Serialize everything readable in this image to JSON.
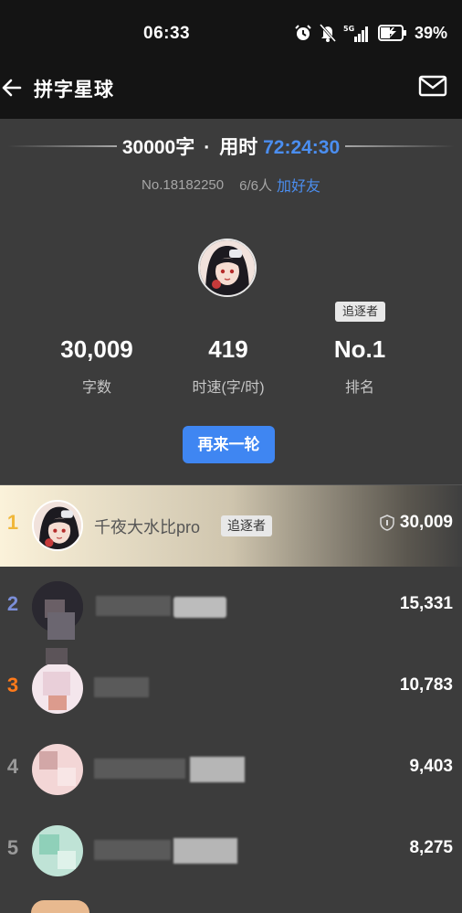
{
  "status_bar": {
    "time": "06:33",
    "battery": "39%"
  },
  "app_bar": {
    "title": "拼字星球"
  },
  "summary": {
    "words": "30000字",
    "dot": "·",
    "time_label": "用时",
    "timer": "72:24:30"
  },
  "room": {
    "number": "No.18182250",
    "players": "6/6人",
    "add_friend": "加好友"
  },
  "my_stats": {
    "chaser_tag": "追逐者",
    "words": "30,009",
    "words_label": "字数",
    "speed": "419",
    "speed_label": "时速(字/时)",
    "rank": "No.1",
    "rank_label": "排名"
  },
  "again_button": "再来一轮",
  "ranking": [
    {
      "rank": "1",
      "name": "千夜大水比pro",
      "tag": "追逐者",
      "score": "30,009",
      "rank_color": "#f0b73a"
    },
    {
      "rank": "2",
      "score": "15,331",
      "rank_color": "#7b8ed8"
    },
    {
      "rank": "3",
      "score": "10,783",
      "rank_color": "#ff7a1a"
    },
    {
      "rank": "4",
      "score": "9,403",
      "rank_color": "#9a9a9a"
    },
    {
      "rank": "5",
      "score": "8,275",
      "rank_color": "#9a9a9a"
    }
  ]
}
